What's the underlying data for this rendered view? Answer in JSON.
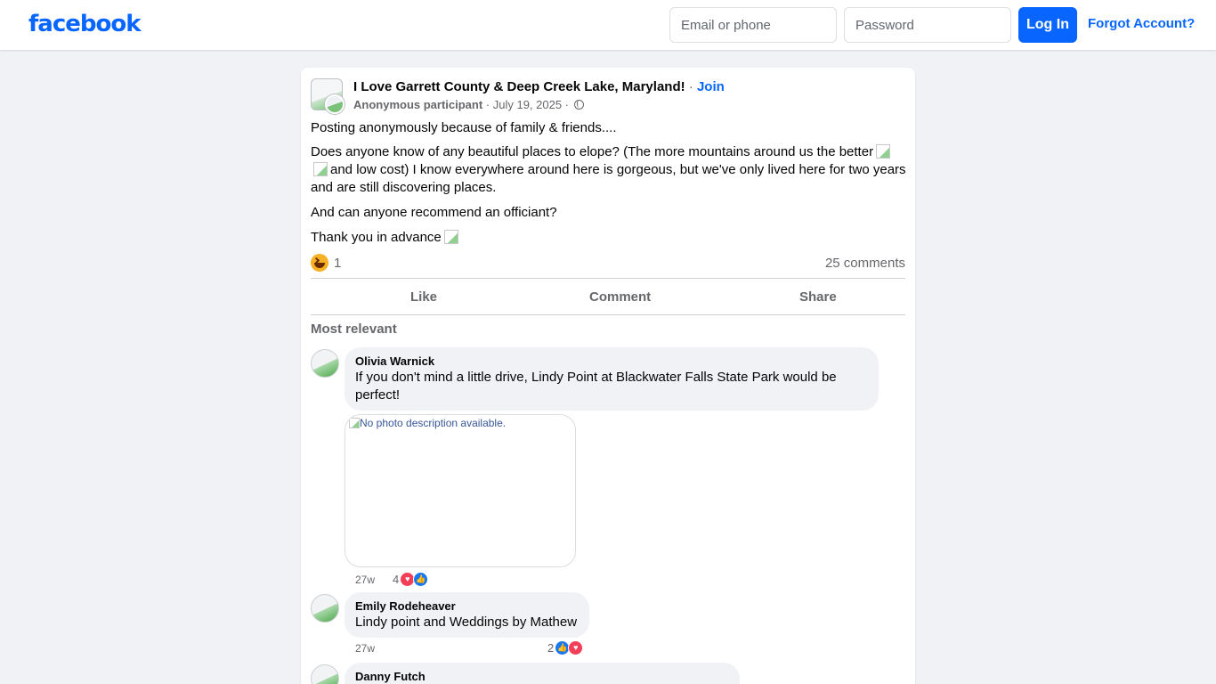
{
  "header": {
    "logo": "facebook",
    "email_placeholder": "Email or phone",
    "password_placeholder": "Password",
    "login_label": "Log In",
    "forgot_label": "Forgot Account?"
  },
  "post": {
    "group_name": "I Love Garrett County & Deep Creek Lake, Maryland!",
    "separator": " · ",
    "join_label": "Join",
    "author": "Anonymous participant",
    "date": " · July 19, 2025 · ",
    "paragraphs": {
      "p1": "Posting anonymously because of family & friends....",
      "p2a": "Does anyone know of any beautiful places to elope? (The more mountains around us the better",
      "p2b": "and low cost) I know everywhere around here is gorgeous, but we've only lived here for two years and are still discovering places.",
      "p3": "And can anyone recommend an officiant?",
      "p4": "Thank you in advance"
    },
    "reaction_count": "1",
    "comment_count": "25 comments",
    "actions": {
      "like": "Like",
      "comment": "Comment",
      "share": "Share"
    },
    "sort_label": "Most relevant"
  },
  "comments": [
    {
      "author": "Olivia Warnick",
      "text": "If you don't mind a little drive, Lindy Point at Blackwater Falls State Park would be perfect!",
      "photo_alt": "No photo description available.",
      "time": "27w",
      "reactions": "4"
    },
    {
      "author": "Emily Rodeheaver",
      "text": "Lindy point and Weddings by Mathew",
      "time": "27w",
      "reactions": "2"
    },
    {
      "author": "Danny Futch"
    }
  ],
  "colors": {
    "brand": "#0866ff",
    "background": "#f0f2f5",
    "secondary_text": "#65676b"
  }
}
